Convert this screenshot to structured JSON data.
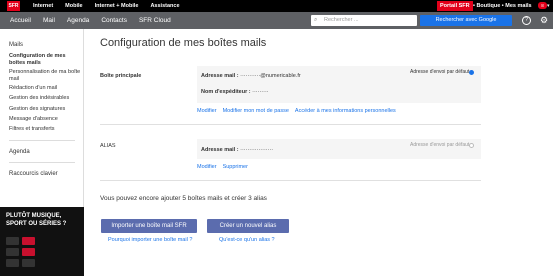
{
  "topbar": {
    "logo": "SFR",
    "nav": [
      "Internet",
      "Mobile",
      "Internet + Mobile",
      "Assistance"
    ],
    "portail": "Portail SFR",
    "links": "• Boutique • Mes mails",
    "badge": "8"
  },
  "appbar": {
    "nav": [
      "Accueil",
      "Mail",
      "Agenda",
      "Contacts",
      "SFR Cloud"
    ],
    "search_placeholder": "Rechercher ...",
    "google_button": "Rechercher avec Google"
  },
  "sidebar": {
    "mails_heading": "Mails",
    "items": [
      "Configuration de mes boîtes mails",
      "Personnalisation de ma boîte mail",
      "Rédaction d'un mail",
      "Gestion des indésirables",
      "Gestion des signatures",
      "Message d'absence",
      "Filtres et transferts"
    ],
    "agenda": "Agenda",
    "raccourcis": "Raccourcis clavier",
    "promo": "PLUTÔT MUSIQUE, SPORT OU SÉRIES ?"
  },
  "main": {
    "title": "Configuration de mes boîtes mails",
    "primary": {
      "label": "Boîte principale",
      "address_label": "Adresse mail :",
      "address_value": "···········@numericable.fr",
      "sender_label": "Nom d'expéditeur :",
      "sender_value": "·········",
      "default_label": "Adresse d'envoi par défaut",
      "links": [
        "Modifier",
        "Modifier mon mot de passe",
        "Accéder à mes informations personnelles"
      ]
    },
    "alias": {
      "label": "ALIAS",
      "address_label": "Adresse mail :",
      "address_value": "··················",
      "default_label": "Adresse d'envoi par défaut",
      "links": [
        "Modifier",
        "Supprimer"
      ]
    },
    "info": "Vous pouvez encore ajouter 5 boîtes mails et créer 3 alias",
    "import_button": "Importer une boîte mail SFR",
    "import_help": "Pourquoi importer une boîte mail ?",
    "alias_button": "Créer un nouvel alias",
    "alias_help": "Qu'est-ce qu'un alias ?"
  },
  "colors": {
    "brand": "#e2001a",
    "appbar": "#5e6064",
    "button": "#5b6cae",
    "link": "#1a73e8"
  }
}
